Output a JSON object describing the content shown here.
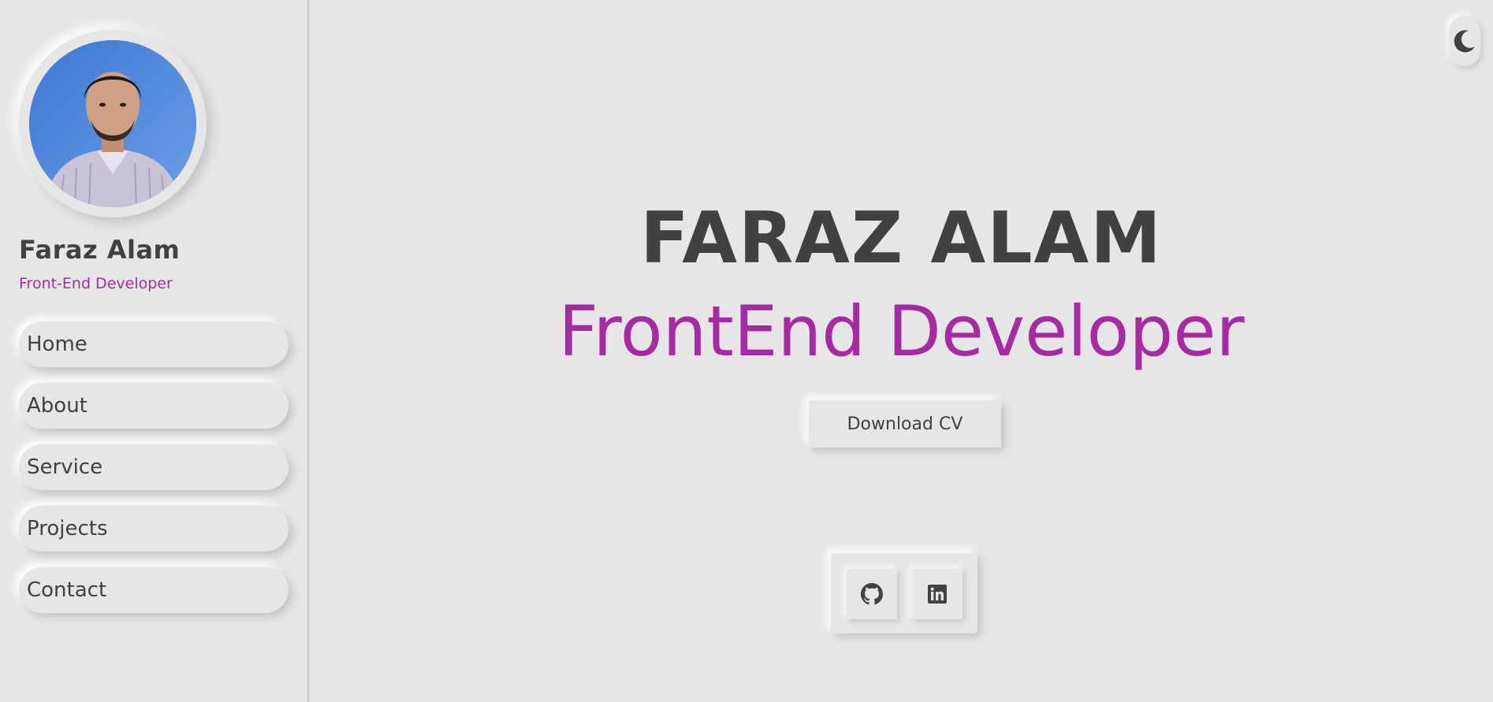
{
  "sidebar": {
    "name": "Faraz Alam",
    "role": "Front-End Developer",
    "avatar_icon": "profile-photo",
    "nav": [
      {
        "label": "Home"
      },
      {
        "label": "About"
      },
      {
        "label": "Service"
      },
      {
        "label": "Projects"
      },
      {
        "label": "Contact"
      }
    ]
  },
  "hero": {
    "name": "FARAZ ALAM",
    "role": "FrontEnd Developer",
    "cv_button": "Download CV"
  },
  "social": [
    {
      "icon": "github-icon"
    },
    {
      "icon": "linkedin-icon"
    }
  ],
  "theme_toggle_icon": "moon-icon",
  "colors": {
    "background": "#e6e6e6",
    "text": "#414141",
    "accent": "#a62aa4"
  }
}
